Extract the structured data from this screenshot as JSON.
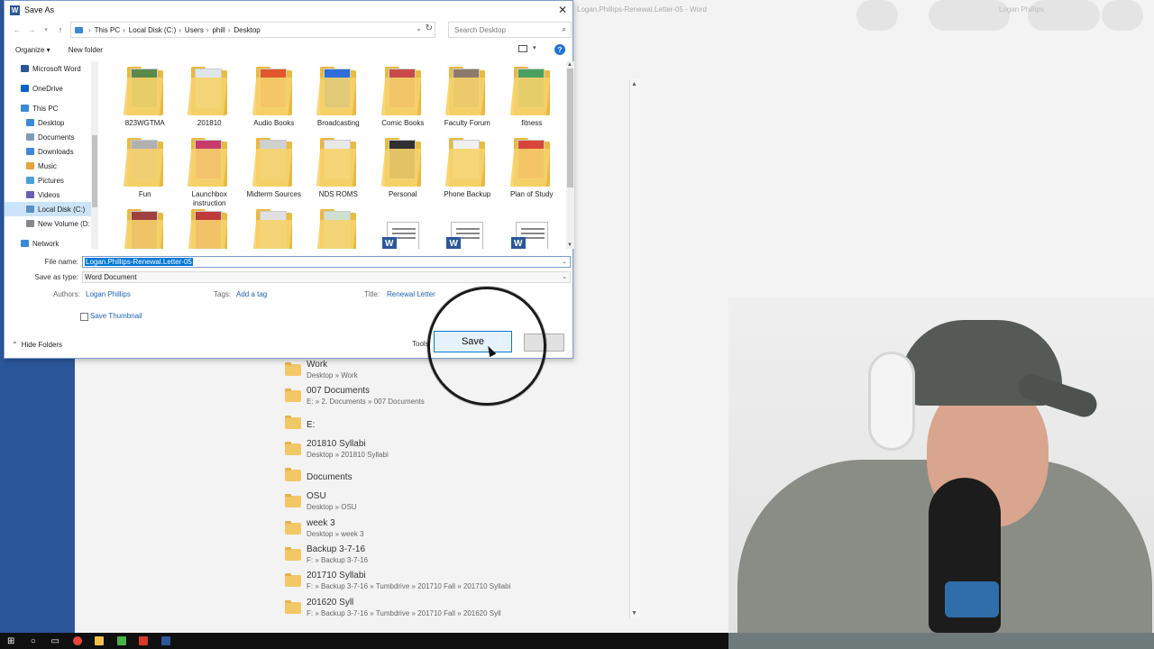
{
  "word": {
    "title": "Logan.Phillips-Renewal.Letter-05 - Word",
    "user": "Logan Phillips",
    "recent": [
      {
        "name": "Work",
        "path": "Desktop » Work"
      },
      {
        "name": "007 Documents",
        "path": "E: » 2. Documents » 007 Documents"
      },
      {
        "name": "E:",
        "path": ""
      },
      {
        "name": "201810 Syllabi",
        "path": "Desktop » 201810 Syllabi"
      },
      {
        "name": "Documents",
        "path": ""
      },
      {
        "name": "OSU",
        "path": "Desktop » OSU"
      },
      {
        "name": "week 3",
        "path": "Desktop » week 3"
      },
      {
        "name": "Backup 3-7-16",
        "path": "F: » Backup 3-7-16"
      },
      {
        "name": "201710 Syllabi",
        "path": "F: » Backup 3-7-16 » Tumbdrive » 201710 Fall » 201710 Syllabi"
      },
      {
        "name": "201620 Syll",
        "path": "F: » Backup 3-7-16 » Tumbdrive » 201710 Fall » 201620 Syll"
      }
    ]
  },
  "dialog": {
    "title": "Save As",
    "breadcrumbs": [
      "This PC",
      "Local Disk (C:)",
      "Users",
      "phill",
      "Desktop"
    ],
    "search_placeholder": "Search Desktop",
    "organize": "Organize ▾",
    "new_folder": "New folder",
    "nav": [
      {
        "label": "Microsoft Word",
        "level": 0,
        "icon": "word-icon",
        "color": "#2b579a"
      },
      {
        "label": "OneDrive",
        "level": 0,
        "icon": "cloud-icon",
        "color": "#0a64c8"
      },
      {
        "label": "This PC",
        "level": 0,
        "icon": "computer-icon",
        "color": "#3b8ad8"
      },
      {
        "label": "Desktop",
        "level": 1,
        "icon": "desktop-icon",
        "color": "#3b8ad8"
      },
      {
        "label": "Documents",
        "level": 1,
        "icon": "documents-icon",
        "color": "#7e9bb8"
      },
      {
        "label": "Downloads",
        "level": 1,
        "icon": "downloads-icon",
        "color": "#3b8ad8"
      },
      {
        "label": "Music",
        "level": 1,
        "icon": "music-icon",
        "color": "#e8a33d"
      },
      {
        "label": "Pictures",
        "level": 1,
        "icon": "pictures-icon",
        "color": "#4aa0d8"
      },
      {
        "label": "Videos",
        "level": 1,
        "icon": "videos-icon",
        "color": "#6a5fb8"
      },
      {
        "label": "Local Disk (C:)",
        "level": 1,
        "icon": "drive-icon",
        "color": "#5a8fc8"
      },
      {
        "label": "New Volume (D:",
        "level": 1,
        "icon": "drive-icon",
        "color": "#888888"
      },
      {
        "label": "Network",
        "level": 0,
        "icon": "network-icon",
        "color": "#3b8ad8"
      }
    ],
    "files": [
      {
        "label": "823WGTMA",
        "type": "folder",
        "color": "#5a8a4a"
      },
      {
        "label": "201810",
        "type": "folder",
        "color": "#dfe6ea"
      },
      {
        "label": "Audio Books",
        "type": "folder",
        "color": "#e0582a"
      },
      {
        "label": "Broadcasting",
        "type": "folder",
        "color": "#2f6ed8"
      },
      {
        "label": "Comic Books",
        "type": "folder",
        "color": "#c84a4a"
      },
      {
        "label": "Faculty Forum",
        "type": "folder",
        "color": "#8c7a6a"
      },
      {
        "label": "fitness",
        "type": "folder",
        "color": "#4aa060"
      },
      {
        "label": "Fun",
        "type": "folder",
        "color": "#b0b0b0"
      },
      {
        "label": "Launchbox instruction",
        "type": "folder",
        "color": "#c83a6a"
      },
      {
        "label": "Midterm Sources",
        "type": "folder",
        "color": "#d0d0d0"
      },
      {
        "label": "NDS ROMS",
        "type": "folder",
        "color": "#e8e8e8"
      },
      {
        "label": "Personal",
        "type": "folder",
        "color": "#303030"
      },
      {
        "label": "Phone Backup",
        "type": "folder",
        "color": "#f0f0f0"
      },
      {
        "label": "Plan of Study",
        "type": "folder",
        "color": "#d8453a"
      },
      {
        "label": "",
        "type": "folder",
        "color": "#a04040"
      },
      {
        "label": "",
        "type": "folder",
        "color": "#c03a3a"
      },
      {
        "label": "",
        "type": "folder",
        "color": "#e0e0e0"
      },
      {
        "label": "",
        "type": "folder",
        "color": "#d0e0d0"
      },
      {
        "label": "",
        "type": "doc",
        "color": "#2b579a"
      },
      {
        "label": "",
        "type": "doc",
        "color": "#2b579a"
      },
      {
        "label": "",
        "type": "doc",
        "color": "#2b579a"
      }
    ],
    "form": {
      "filename_label": "File name:",
      "filename_value": "Logan.Phillips-Renewal.Letter-05",
      "savetype_label": "Save as type:",
      "savetype_value": "Word Document",
      "authors_label": "Authors:",
      "authors_value": "Logan Phillips",
      "tags_label": "Tags:",
      "tags_value": "Add a tag",
      "title_label": "Title:",
      "title_value": "Renewal Letter",
      "thumbnail_label": "Save Thumbnail"
    },
    "hide_folders": "Hide Folders",
    "tools": "Tools",
    "save": "Save"
  }
}
